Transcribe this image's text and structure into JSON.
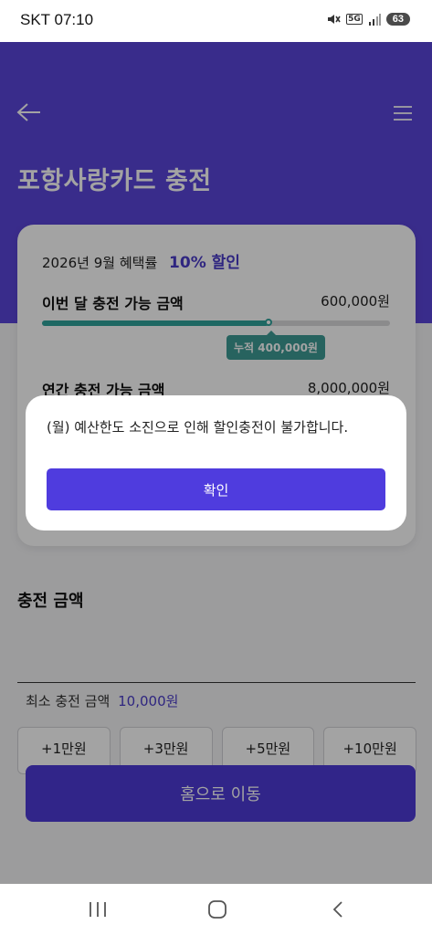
{
  "status_bar": {
    "carrier": "SKT",
    "time": "07:10",
    "network": "5G",
    "battery": "63"
  },
  "header": {
    "title": "포항사랑카드 충전"
  },
  "card": {
    "benefit_prefix": "2026년 9월 혜택률",
    "benefit_rate": "10% 할인",
    "monthly_label": "이번 달 충전 가능 금액",
    "monthly_amount": "600,000원",
    "monthly_progress": 0.65,
    "cumulative_label": "누적 400,000원",
    "annual_label": "연간 충전 가능 금액",
    "annual_amount": "8,000,000원"
  },
  "charge": {
    "section_title": "충전 금액",
    "input_value": "",
    "min_prefix": "최소 충전 금액",
    "min_value": "10,000원",
    "quick_buttons": [
      "+1만원",
      "+3만원",
      "+5만원",
      "+10만원"
    ]
  },
  "footer": {
    "home_button": "홈으로 이동"
  },
  "dialog": {
    "message": "(월) 예산한도 소진으로 인해 할인충전이 불가합니다.",
    "confirm_button": "확인"
  },
  "colors": {
    "brand": "#5a45d9",
    "accent_teal": "#2fa39c",
    "button": "#4f3cde"
  }
}
